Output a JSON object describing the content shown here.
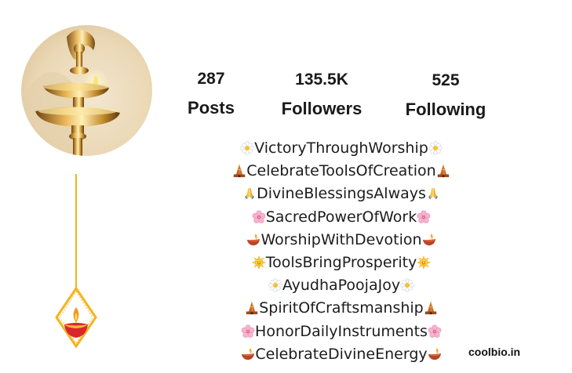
{
  "profile": {
    "avatar_icon": "brass-oil-lamp-photo"
  },
  "stats": {
    "posts": {
      "value": "287",
      "label": "Posts"
    },
    "followers": {
      "value": "135.5K",
      "label": "Followers"
    },
    "following": {
      "value": "525",
      "label": "Following"
    }
  },
  "bio": {
    "lines": [
      {
        "text": "VictoryThroughWorship",
        "icon": "daisy-icon"
      },
      {
        "text": "CelebrateToolsOfCreation",
        "icon": "temple-icon"
      },
      {
        "text": "DivineBlessingsAlways",
        "icon": "folded-hands-icon"
      },
      {
        "text": "SacredPowerOfWork",
        "icon": "cherry-blossom-icon"
      },
      {
        "text": "WorshipWithDevotion",
        "icon": "diya-lamp-icon"
      },
      {
        "text": "ToolsBringProsperity",
        "icon": "sun-icon"
      },
      {
        "text": "AyudhaPoojaJoy",
        "icon": "daisy-icon"
      },
      {
        "text": "SpiritOfCraftsmanship",
        "icon": "temple-icon"
      },
      {
        "text": "HonorDailyInstruments",
        "icon": "cherry-blossom-icon"
      },
      {
        "text": "CelebrateDivineEnergy",
        "icon": "diya-lamp-icon"
      }
    ]
  },
  "decoration": {
    "hanging_icon": "hanging-diya-icon"
  },
  "watermark": "coolbio.in",
  "colors": {
    "text": "#1a1a1a",
    "accent_gold": "#f2b51e",
    "flame_orange": "#f7941d",
    "diya_red": "#d8262c"
  }
}
